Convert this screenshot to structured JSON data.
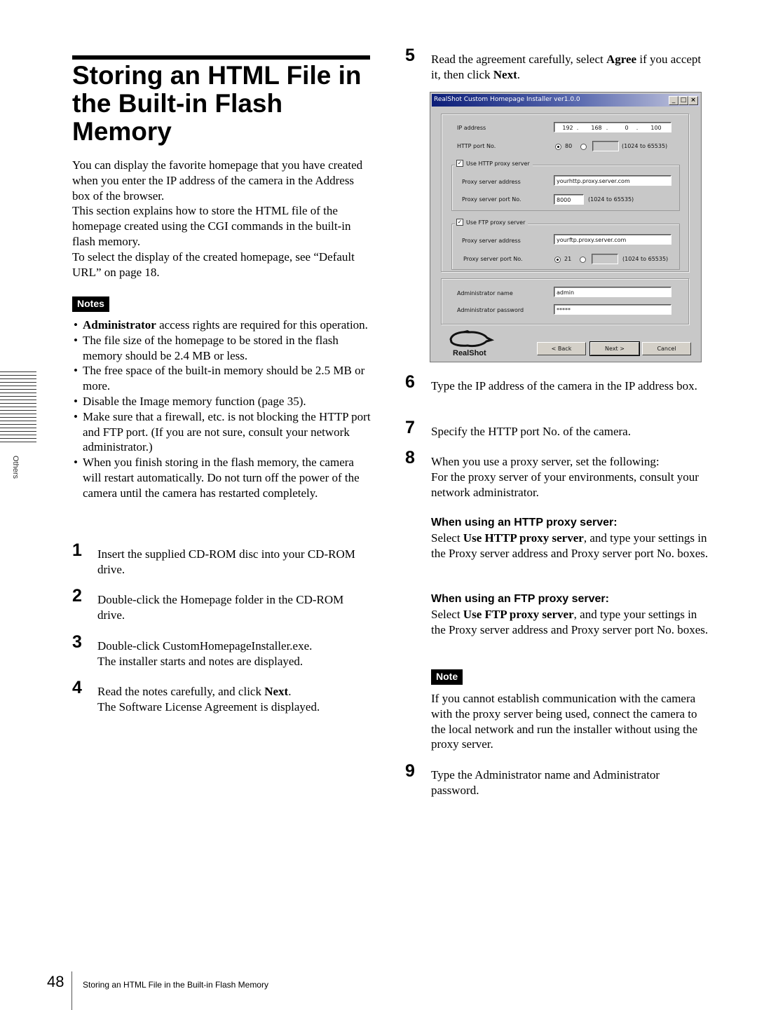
{
  "title": "Storing an HTML File in the Built-in Flash Memory",
  "intro": [
    "You can display the favorite homepage that you have created when you enter the IP address of the camera in the Address box of the browser.",
    "This section explains how to store the HTML file of the homepage created using the CGI commands in the built-in flash memory.",
    "To select the display of the created homepage, see “Default URL” on page 18."
  ],
  "notes": {
    "badge": "Notes",
    "items": [
      {
        "bold": "Administrator",
        "text": " access rights are required for this operation."
      },
      {
        "bold": "",
        "text": "The file size of the homepage to be stored in the flash memory should be 2.4 MB or less."
      },
      {
        "bold": "",
        "text": "The free space of the built-in memory should be 2.5 MB or more."
      },
      {
        "bold": "",
        "text": "Disable the Image memory function (page 35)."
      },
      {
        "bold": "",
        "text": "Make sure that a firewall, etc. is not blocking the HTTP port and FTP port.  (If you are not sure, consult your network administrator.)"
      },
      {
        "bold": "",
        "text": "When you finish storing in the flash memory, the camera will restart automatically.  Do not turn off the power of the camera until the camera has restarted completely."
      }
    ]
  },
  "steps": [
    {
      "num": "1",
      "lines": [
        "Insert the supplied CD-ROM disc into your CD-ROM drive."
      ]
    },
    {
      "num": "2",
      "lines": [
        "Double-click the Homepage folder in the CD-ROM drive."
      ]
    },
    {
      "num": "3",
      "lines": [
        "Double-click CustomHomepageInstaller.exe.",
        "The installer starts and notes are displayed."
      ]
    },
    {
      "num": "4",
      "pre": "Read the notes carefully, and click ",
      "bold": "Next",
      "post": ".",
      "line2": "The Software License Agreement is displayed."
    },
    {
      "num": "5",
      "pre": "Read the agreement carefully, select ",
      "bold": "Agree",
      "mid": " if you accept it, then click ",
      "bold2": "Next",
      "post": "."
    },
    {
      "num": "6",
      "lines": [
        "Type the IP address of the camera in the IP address box."
      ]
    },
    {
      "num": "7",
      "lines": [
        "Specify the HTTP port No. of the camera."
      ]
    },
    {
      "num": "8",
      "lines": [
        "When you use a proxy server, set the following:",
        "For the proxy server of your environments, consult your network administrator."
      ]
    },
    {
      "num": "9",
      "lines": [
        "Type the Administrator name and Administrator password."
      ]
    }
  ],
  "http_proxy": {
    "heading": "When using an HTTP proxy server:",
    "pre": "Select ",
    "bold": "Use HTTP proxy server",
    "post": ", and type your settings in the Proxy server address  and Proxy server port No. boxes."
  },
  "ftp_proxy": {
    "heading": "When using an FTP proxy server:",
    "pre": "Select ",
    "bold": "Use FTP proxy server",
    "post": ", and type your settings in the Proxy server address and Proxy server port No. boxes."
  },
  "note": {
    "badge": "Note",
    "text": "If you cannot establish communication with the camera with the proxy server being used, connect the camera to the local network and run the installer without using the proxy server."
  },
  "dialog": {
    "title": "RealShot Custom Homepage Installer ver1.0.0",
    "min_icon": "_",
    "max_icon": "□",
    "close_icon": "×",
    "ip_label": "IP address",
    "ip": [
      "192",
      "168",
      "0",
      "100"
    ],
    "ip_sep": ".",
    "http_port_label": "HTTP port No.",
    "http_port_default": "80",
    "http_port_custom": "",
    "http_port_selected": "default",
    "range_hint": "(1024 to 65535)",
    "use_http_proxy_label": "Use HTTP proxy server",
    "use_http_proxy_checked": true,
    "http_proxy_address_label": "Proxy server address",
    "http_proxy_address": "yourhttp.proxy.server.com",
    "http_proxy_port_label": "Proxy server port No.",
    "http_proxy_port": "8000",
    "use_ftp_proxy_label": "Use FTP proxy server",
    "use_ftp_proxy_checked": true,
    "ftp_proxy_address_label": "Proxy server address",
    "ftp_proxy_address": "yourftp.proxy.server.com",
    "ftp_proxy_port_label": "Proxy server port No.",
    "ftp_proxy_port_default": "21",
    "ftp_proxy_port_custom": "",
    "admin_name_label": "Administrator name",
    "admin_name": "admin",
    "admin_password_label": "Administrator password",
    "admin_password": "*****",
    "back_label": "< Back",
    "next_label": "Next >",
    "cancel_label": "Cancel",
    "logo_text": "RealShot",
    "check_mark": "✓"
  },
  "side_tab": "Others",
  "footer": {
    "page_number": "48",
    "text": "Storing an HTML File in the Built-in Flash Memory"
  }
}
